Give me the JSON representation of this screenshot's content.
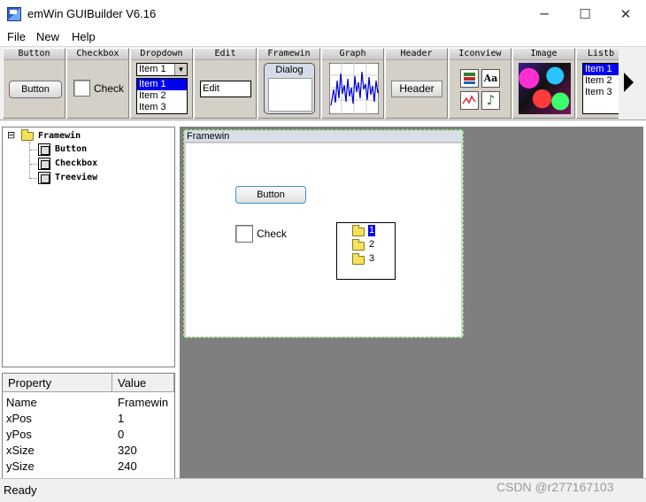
{
  "window": {
    "title": "emWin GUIBuilder V6.16",
    "minimize_icon": "─",
    "maximize_icon": "☐",
    "close_icon": "✕"
  },
  "menu": {
    "items": [
      "File",
      "New",
      "Help"
    ]
  },
  "toolbar": {
    "widgets": [
      {
        "label": "Button",
        "preview": "Button"
      },
      {
        "label": "Checkbox",
        "preview": "Check"
      },
      {
        "label": "Dropdown",
        "preview": "Item 1",
        "items": [
          "Item 1",
          "Item 2",
          "Item 3"
        ]
      },
      {
        "label": "Edit",
        "preview": "Edit"
      },
      {
        "label": "Framewin",
        "preview": "Dialog"
      },
      {
        "label": "Graph"
      },
      {
        "label": "Header",
        "preview": "Header"
      },
      {
        "label": "Iconview",
        "preview": "Aa"
      },
      {
        "label": "Image"
      },
      {
        "label": "Listb",
        "items": [
          "Item 1",
          "Item 2",
          "Item 3"
        ]
      }
    ],
    "dropdown_arrow_icon": "▼",
    "scroll_right_icon": "triangle-right"
  },
  "tree": {
    "expander": "⊟",
    "root": "Framewin",
    "children": [
      "Button",
      "Checkbox",
      "Treeview"
    ]
  },
  "properties": {
    "headers": [
      "Property",
      "Value"
    ],
    "rows": [
      {
        "name": "Name",
        "value": "Framewin"
      },
      {
        "name": "xPos",
        "value": "1"
      },
      {
        "name": "yPos",
        "value": "0"
      },
      {
        "name": "xSize",
        "value": "320"
      },
      {
        "name": "ySize",
        "value": "240"
      }
    ]
  },
  "canvas": {
    "framewin_title": "Framewin",
    "button_label": "Button",
    "checkbox_label": "Check",
    "treeview_items": [
      "1",
      "2",
      "3"
    ]
  },
  "status": {
    "text": "Ready",
    "watermark": "CSDN @r277167103"
  },
  "colors": {
    "selection": "#0000ee",
    "design_bg": "#7f7f7f",
    "frame_border": "#3cb043",
    "button_border": "#3a8fd8"
  }
}
